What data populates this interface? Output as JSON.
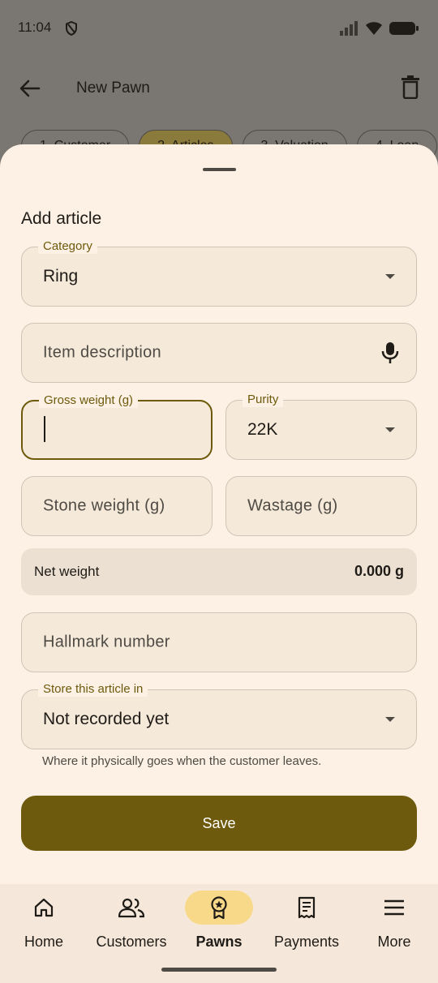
{
  "status_bar": {
    "time": "11:04"
  },
  "app_bar": {
    "title": "New Pawn"
  },
  "steps": [
    {
      "label": "1. Customer"
    },
    {
      "label": "2. Articles"
    },
    {
      "label": "3. Valuation"
    },
    {
      "label": "4. Loan"
    }
  ],
  "sheet": {
    "title": "Add article",
    "category": {
      "label": "Category",
      "value": "Ring"
    },
    "description": {
      "placeholder": "Item description"
    },
    "gross_weight": {
      "label": "Gross weight (g)",
      "value": ""
    },
    "purity": {
      "label": "Purity",
      "value": "22K"
    },
    "stone_weight": {
      "placeholder": "Stone weight (g)"
    },
    "wastage": {
      "placeholder": "Wastage (g)"
    },
    "net_weight": {
      "label": "Net weight",
      "value": "0.000 g"
    },
    "hallmark": {
      "placeholder": "Hallmark number"
    },
    "storage": {
      "label": "Store this article in",
      "value": "Not recorded yet",
      "helper": "Where it physically goes when the customer leaves."
    },
    "save_label": "Save"
  },
  "nav": [
    {
      "label": "Home",
      "icon": "home-icon"
    },
    {
      "label": "Customers",
      "icon": "customers-icon"
    },
    {
      "label": "Pawns",
      "icon": "pawn-badge-icon",
      "active": true
    },
    {
      "label": "Payments",
      "icon": "receipt-icon"
    },
    {
      "label": "More",
      "icon": "menu-icon"
    }
  ],
  "colors": {
    "primary": "#6e5a0c",
    "sheet_bg": "#fcf1e4",
    "field_bg": "#f5e9da",
    "nav_active": "#f8d98a"
  }
}
